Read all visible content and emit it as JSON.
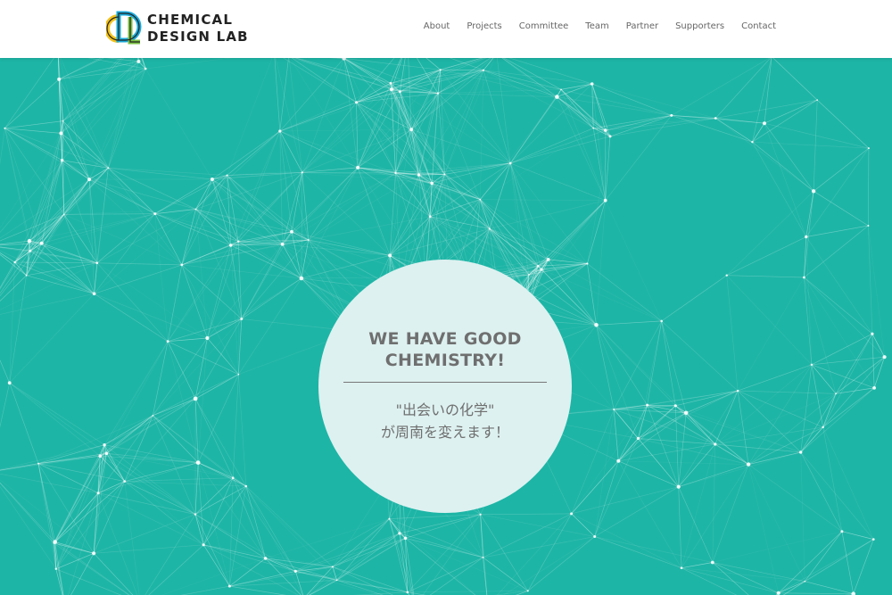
{
  "brand": {
    "line1": "CHEMICAL",
    "line2": "DESIGN LAB",
    "mark_letters": "CDL",
    "colors": [
      "#f2c21b",
      "#1aa9d9",
      "#7cc143",
      "#222222"
    ]
  },
  "nav": {
    "items": [
      {
        "label": "About"
      },
      {
        "label": "Projects"
      },
      {
        "label": "Committee"
      },
      {
        "label": "Team"
      },
      {
        "label": "Partner"
      },
      {
        "label": "Supporters"
      },
      {
        "label": "Contact"
      }
    ]
  },
  "hero": {
    "background": "#1db5a6",
    "headline_line1": "WE HAVE GOOD",
    "headline_line2": "CHEMISTRY!",
    "sub_line1": "\"出会いの化学\"",
    "sub_line2": "が周南を変えます！"
  }
}
